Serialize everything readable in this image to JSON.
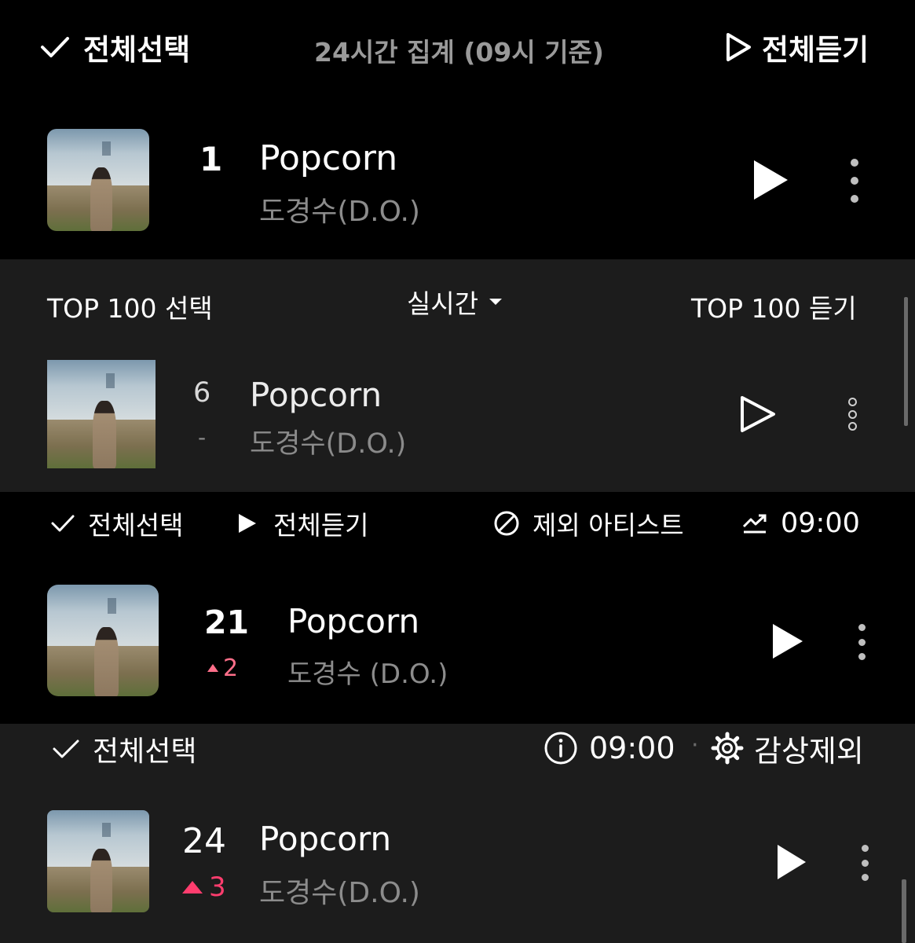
{
  "panel1": {
    "select_all": "전체선택",
    "aggregate": "24시간 집계 (09시 기준)",
    "play_all": "전체듣기",
    "track": {
      "rank": "1",
      "title": "Popcorn",
      "artist": "도경수(D.O.)"
    }
  },
  "panel2": {
    "select_top": "TOP 100 선택",
    "mode": "실시간",
    "play_top": "TOP 100 듣기",
    "track": {
      "rank": "6",
      "change": "-",
      "title": "Popcorn",
      "artist": "도경수(D.O.)"
    }
  },
  "panel3": {
    "select_all": "전체선택",
    "play_all": "전체듣기",
    "exclude_artist": "제외 아티스트",
    "time": "09:00",
    "track": {
      "rank": "21",
      "change": "2",
      "title": "Popcorn",
      "artist": "도경수 (D.O.)"
    }
  },
  "panel4": {
    "select_all": "전체선택",
    "time": "09:00",
    "separator": "·",
    "exclude_listen": "감상제외",
    "track": {
      "rank": "24",
      "change": "3",
      "title": "Popcorn",
      "artist": "도경수(D.O.)"
    }
  },
  "colors": {
    "up_pink": "#ff6f8a",
    "up_red": "#ff3d6e",
    "panel_gray": "#1c1c1c"
  }
}
